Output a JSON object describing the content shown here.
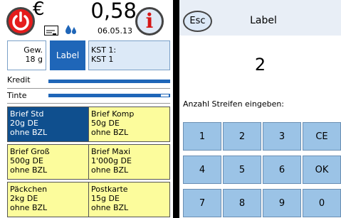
{
  "header": {
    "currency": "€",
    "amount": "0,58",
    "date": "06.05.13"
  },
  "icons": {
    "power": "power-icon",
    "info": "info-icon",
    "meter": "meter-card-icon",
    "drops": "ink-drops-icon"
  },
  "tabs": {
    "gew_line1": "Gew.",
    "gew_line2": "18 g",
    "label": "Label",
    "kst_line1": "KST 1:",
    "kst_line2": "KST 1"
  },
  "gauges": {
    "kredit_label": "Kredit",
    "kredit_level": 1.0,
    "tinte_label": "Tinte",
    "tinte_level": 0.93
  },
  "products": [
    {
      "l1": "Brief Std",
      "l2": "20g DE",
      "l3": "ohne BZL"
    },
    {
      "l1": "Brief Komp",
      "l2": "50g DE",
      "l3": "ohne BZL"
    },
    {
      "l1": "Brief Groß",
      "l2": "500g DE",
      "l3": "ohne BZL"
    },
    {
      "l1": "Brief Maxi",
      "l2": "1'000g DE",
      "l3": "ohne BZL"
    },
    {
      "l1": "Päckchen",
      "l2": "2kg DE",
      "l3": "ohne BZL"
    },
    {
      "l1": "Postkarte",
      "l2": "15g DE",
      "l3": "ohne BZL"
    }
  ],
  "dialog": {
    "esc": "Esc",
    "title": "Label",
    "value": "2",
    "prompt": "Anzahl Streifen eingeben:"
  },
  "keypad": {
    "k1": "1",
    "k2": "2",
    "k3": "3",
    "ce": "CE",
    "k4": "4",
    "k5": "5",
    "k6": "6",
    "ok": "OK",
    "k7": "7",
    "k8": "8",
    "k9": "9",
    "k0": "0"
  },
  "colors": {
    "accent": "#1f66b8",
    "selected_product": "#0f4f8e",
    "product_bg": "#fcfc9c",
    "power": "#e51c1c",
    "key_bg": "#9bc3e6"
  }
}
